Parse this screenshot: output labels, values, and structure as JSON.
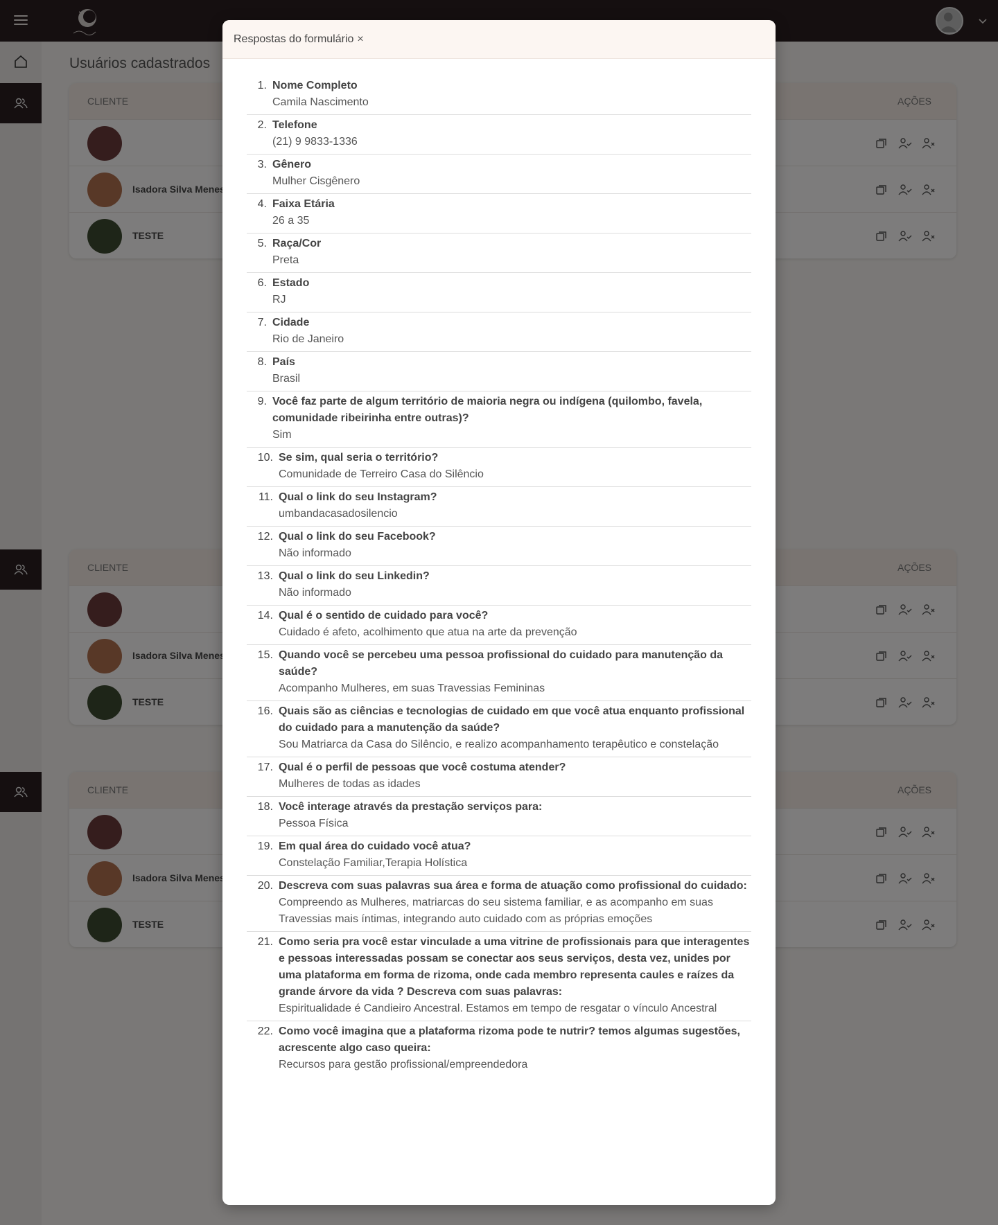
{
  "header": {
    "logo_alt": "logo"
  },
  "page": {
    "title": "Usuários cadastrados"
  },
  "tables": [
    {
      "col_client": "CLIENTE",
      "col_actions": "AÇÕES",
      "rows": [
        {
          "name": ""
        },
        {
          "name": "Isadora Silva Menes"
        },
        {
          "name": "TESTE"
        }
      ]
    },
    {
      "col_client": "CLIENTE",
      "col_actions": "AÇÕES",
      "rows": [
        {
          "name": ""
        },
        {
          "name": "Isadora Silva Menes"
        },
        {
          "name": "TESTE"
        }
      ]
    },
    {
      "col_client": "CLIENTE",
      "col_actions": "AÇÕES",
      "rows": [
        {
          "name": ""
        },
        {
          "name": "Isadora Silva Menes"
        },
        {
          "name": "TESTE"
        }
      ]
    }
  ],
  "modal": {
    "title": "Respostas do formulário",
    "close": "×",
    "items": [
      {
        "num": "1.",
        "q": "Nome Completo",
        "a": "Camila Nascimento"
      },
      {
        "num": "2.",
        "q": "Telefone",
        "a": "(21) 9 9833-1336"
      },
      {
        "num": "3.",
        "q": "Gênero",
        "a": "Mulher Cisgênero"
      },
      {
        "num": "4.",
        "q": "Faixa Etária",
        "a": "26 a 35"
      },
      {
        "num": "5.",
        "q": "Raça/Cor",
        "a": "Preta"
      },
      {
        "num": "6.",
        "q": "Estado",
        "a": "RJ"
      },
      {
        "num": "7.",
        "q": "Cidade",
        "a": "Rio de Janeiro"
      },
      {
        "num": "8.",
        "q": "País",
        "a": "Brasil"
      },
      {
        "num": "9.",
        "q": "Você faz parte de algum território de maioria negra ou indígena (quilombo, favela, comunidade ribeirinha entre outras)?",
        "a": "Sim"
      },
      {
        "num": "10.",
        "q": "Se sim, qual seria o território?",
        "a": "Comunidade de Terreiro Casa do Silêncio"
      },
      {
        "num": "11.",
        "q": "Qual o link do seu Instagram?",
        "a": "umbandacasadosilencio"
      },
      {
        "num": "12.",
        "q": "Qual o link do seu Facebook?",
        "a": "Não informado"
      },
      {
        "num": "13.",
        "q": "Qual o link do seu Linkedin?",
        "a": "Não informado"
      },
      {
        "num": "14.",
        "q": "Qual é o sentido de cuidado para você?",
        "a": "Cuidado é afeto, acolhimento que atua na arte da prevenção"
      },
      {
        "num": "15.",
        "q": "Quando você se percebeu uma pessoa profissional do cuidado para manutenção da saúde?",
        "a": "Acompanho Mulheres, em suas Travessias Femininas"
      },
      {
        "num": "16.",
        "q": "Quais são as ciências e tecnologias de cuidado em que você atua enquanto profissional do cuidado para a manutenção da saúde?",
        "a": "Sou Matriarca da Casa do Silêncio, e realizo acompanhamento terapêutico e constelação"
      },
      {
        "num": "17.",
        "q": "Qual é o perfil de pessoas que você costuma atender?",
        "a": "Mulheres de todas as idades"
      },
      {
        "num": "18.",
        "q": "Você interage através da prestação serviços para:",
        "a": "Pessoa Física"
      },
      {
        "num": "19.",
        "q": "Em qual área do cuidado você atua?",
        "a": "Constelação Familiar,Terapia Holística"
      },
      {
        "num": "20.",
        "q": "Descreva com suas palavras sua área e forma de atuação como profissional do cuidado:",
        "a": "Compreendo as Mulheres, matriarcas do seu sistema familiar, e as acompanho em suas Travessias mais íntimas, integrando auto cuidado com as próprias emoções"
      },
      {
        "num": "21.",
        "q": "Como seria pra você estar vinculade a uma vitrine de profissionais para que interagentes e pessoas interessadas possam se conectar aos seus serviços, desta vez, unides por uma plataforma em forma de rizoma, onde cada membro representa caules e raízes da grande árvore da vida ? Descreva com suas palavras:",
        "a": "Espiritualidade é Candieiro Ancestral. Estamos em tempo de resgatar o vínculo Ancestral"
      },
      {
        "num": "22.",
        "q": "Como você imagina que a plataforma rizoma pode te nutrir? temos algumas sugestões, acrescente algo caso queira:",
        "a": "Recursos para gestão profissional/empreendedora"
      }
    ]
  }
}
